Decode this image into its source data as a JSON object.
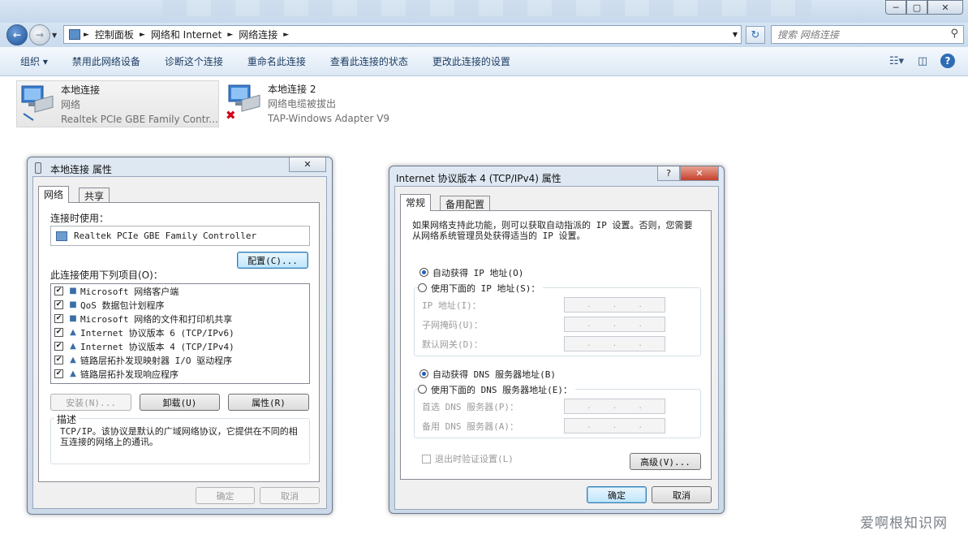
{
  "window": {
    "min_glyph": "─",
    "max_glyph": "▢",
    "close_glyph": "✕"
  },
  "address": {
    "crumbs": [
      "控制面板",
      "网络和 Internet",
      "网络连接"
    ],
    "search_placeholder": "搜索 网络连接"
  },
  "toolbar": {
    "items": [
      "组织 ▾",
      "禁用此网络设备",
      "诊断这个连接",
      "重命名此连接",
      "查看此连接的状态",
      "更改此连接的设置"
    ]
  },
  "adapters": [
    {
      "name": "本地连接",
      "status": "网络",
      "device": "Realtek PCIe GBE Family Contr..."
    },
    {
      "name": "本地连接 2",
      "status": "网络电缆被拔出",
      "device": "TAP-Windows Adapter V9"
    }
  ],
  "dialog1": {
    "title": "本地连接 属性",
    "tabs": [
      "网络",
      "共享"
    ],
    "connect_using_label": "连接时使用：",
    "adapter_name": "Realtek PCIe GBE Family Controller",
    "configure_button": "配置(C)...",
    "items_label": "此连接使用下列项目(O)：",
    "items": [
      {
        "label": "Microsoft 网络客户端",
        "checked": true,
        "icon": "network-client-icon"
      },
      {
        "label": "QoS 数据包计划程序",
        "checked": true,
        "icon": "qos-icon"
      },
      {
        "label": "Microsoft 网络的文件和打印机共享",
        "checked": true,
        "icon": "file-share-icon"
      },
      {
        "label": "Internet 协议版本 6 (TCP/IPv6)",
        "checked": true,
        "icon": "protocol-icon"
      },
      {
        "label": "Internet 协议版本 4 (TCP/IPv4)",
        "checked": true,
        "icon": "protocol-icon"
      },
      {
        "label": "链路层拓扑发现映射器 I/O 驱动程序",
        "checked": true,
        "icon": "protocol-icon"
      },
      {
        "label": "链路层拓扑发现响应程序",
        "checked": true,
        "icon": "protocol-icon"
      }
    ],
    "install_button": "安装(N)...",
    "uninstall_button": "卸载(U)",
    "properties_button": "属性(R)",
    "description_label": "描述",
    "description_text": "TCP/IP。该协议是默认的广域网络协议，它提供在不同的相互连接的网络上的通讯。",
    "ok_button": "确定",
    "cancel_button": "取消"
  },
  "dialog2": {
    "title": "Internet 协议版本 4 (TCP/IPv4) 属性",
    "tabs": [
      "常规",
      "备用配置"
    ],
    "intro": "如果网络支持此功能，则可以获取自动指派的 IP 设置。否则，您需要从网络系统管理员处获得适当的 IP 设置。",
    "auto_ip": "自动获得 IP 地址(O)",
    "manual_ip": "使用下面的 IP 地址(S)：",
    "ip_label": "IP 地址(I)：",
    "mask_label": "子网掩码(U)：",
    "gateway_label": "默认网关(D)：",
    "auto_dns": "自动获得 DNS 服务器地址(B)",
    "manual_dns": "使用下面的 DNS 服务器地址(E)：",
    "dns1_label": "首选 DNS 服务器(P)：",
    "dns2_label": "备用 DNS 服务器(A)：",
    "validate_label": "退出时验证设置(L)",
    "advanced_button": "高级(V)...",
    "ok_button": "确定",
    "cancel_button": "取消",
    "help_glyph": "?",
    "close_glyph": "✕",
    "ip_dot": "."
  },
  "watermark": "爱啊根知识网"
}
